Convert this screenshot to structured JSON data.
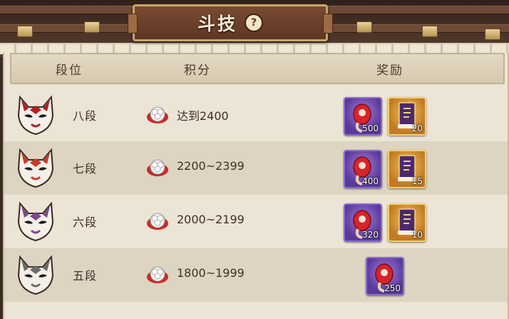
{
  "title": "斗技",
  "help_icon": "?",
  "headers": {
    "rank": "段位",
    "score": "积分",
    "reward": "奖励"
  },
  "rows": [
    {
      "rank": "八段",
      "score": "达到2400",
      "mask_color": "#b01e22",
      "rewards": [
        {
          "type": "purple",
          "count": "500"
        },
        {
          "type": "gold",
          "count": "20"
        }
      ]
    },
    {
      "rank": "七段",
      "score": "2200~2399",
      "mask_color": "#c83a2a",
      "rewards": [
        {
          "type": "purple",
          "count": "400"
        },
        {
          "type": "gold",
          "count": "15"
        }
      ]
    },
    {
      "rank": "六段",
      "score": "2000~2199",
      "mask_color": "#7a4a8c",
      "rewards": [
        {
          "type": "purple",
          "count": "320"
        },
        {
          "type": "gold",
          "count": "10"
        }
      ]
    },
    {
      "rank": "五段",
      "score": "1800~1999",
      "mask_color": "#6b6b6b",
      "rewards": [
        {
          "type": "purple",
          "count": "250"
        }
      ]
    }
  ]
}
